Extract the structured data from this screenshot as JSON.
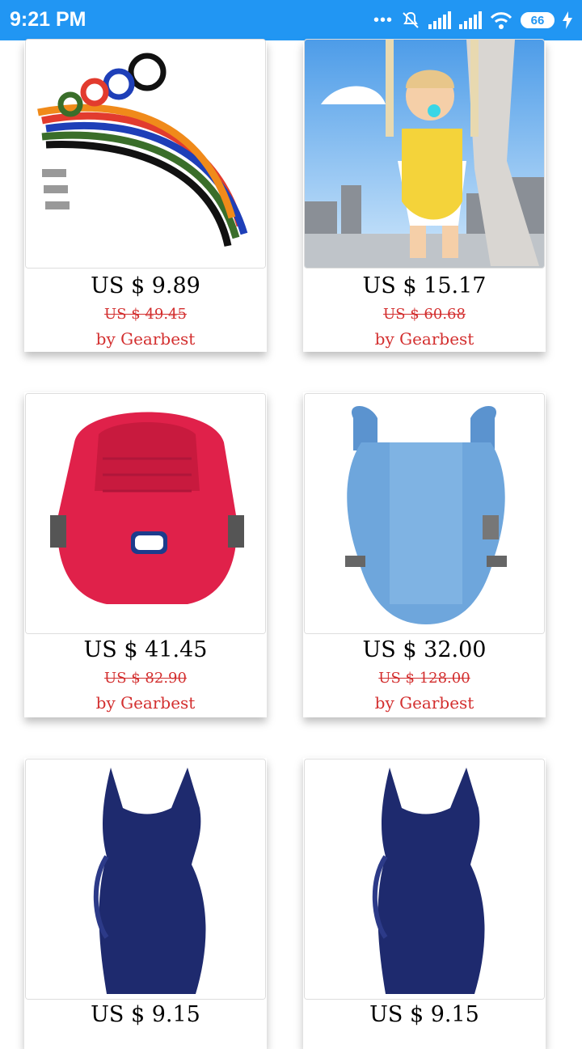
{
  "status_bar": {
    "time": "9:21 PM",
    "battery_level": "66"
  },
  "products": [
    {
      "price": "US $ 9.89",
      "old_price": "US $ 49.45",
      "seller": "by Gearbest",
      "image": "braided-leashes"
    },
    {
      "price": "US $ 15.17",
      "old_price": "US $ 60.68",
      "seller": "by Gearbest",
      "image": "baby-walker-harness"
    },
    {
      "price": "US $ 41.45",
      "old_price": "US $ 82.90",
      "seller": "by Gearbest",
      "image": "red-baby-carrier"
    },
    {
      "price": "US $ 32.00",
      "old_price": "US $ 128.00",
      "seller": "by Gearbest",
      "image": "blue-baby-carrier"
    },
    {
      "price": "US $ 9.15",
      "old_price": "",
      "seller": "",
      "image": "navy-maternity-dress"
    },
    {
      "price": "US $ 9.15",
      "old_price": "",
      "seller": "",
      "image": "navy-maternity-dress"
    }
  ],
  "colors": {
    "status_bar": "#2196f3",
    "discount_red": "#d32f2f"
  }
}
